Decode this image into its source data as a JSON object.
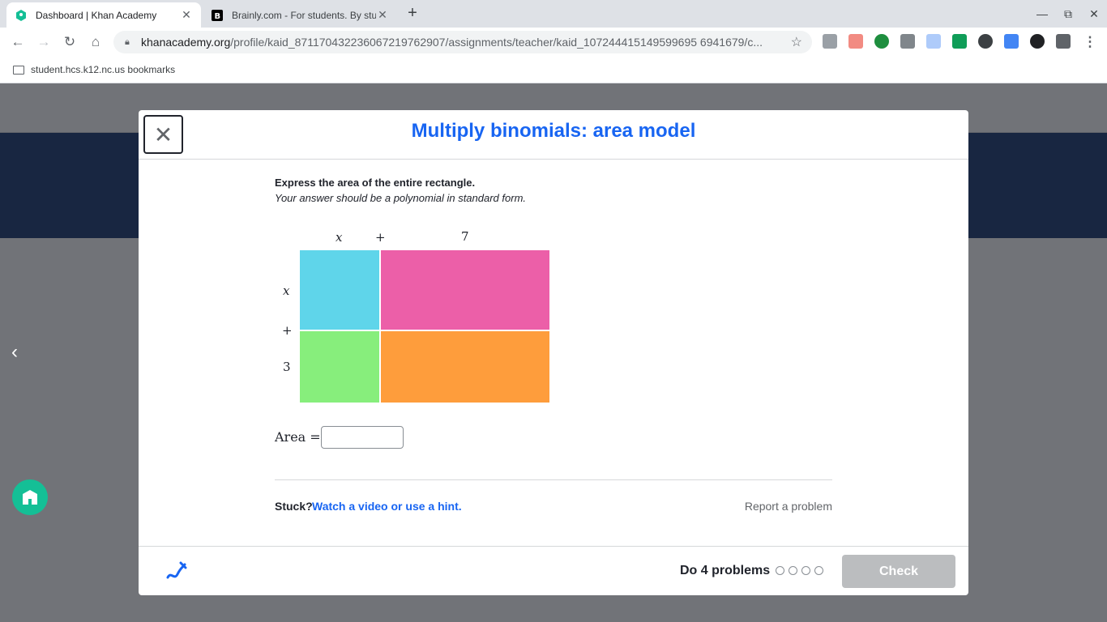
{
  "browser": {
    "tabs": [
      {
        "title": "Dashboard | Khan Academy",
        "active": true
      },
      {
        "title": "Brainly.com - For students. By students.",
        "active": false
      }
    ],
    "url_domain": "khanacademy.org",
    "url_path": "/profile/kaid_871170432236067219762907/assignments/teacher/kaid_107244415149599695 6941679/c...",
    "bookmark_folder": "student.hcs.k12.nc.us bookmarks"
  },
  "modal": {
    "title": "Multiply binomials: area model",
    "question": "Express the area of the entire rectangle.",
    "instruction": "Your answer should be a polynomial in standard form.",
    "diagram": {
      "top_labels": [
        "x",
        "+",
        "7"
      ],
      "side_labels": [
        "x",
        "+",
        "3"
      ],
      "colors": {
        "top_left": "#5fd5ea",
        "top_right": "#ec5fa8",
        "bottom_left": "#87ee7c",
        "bottom_right": "#fe9d3c"
      }
    },
    "area_label": "Area =",
    "area_value": "",
    "stuck_label": "Stuck?",
    "hint_link": "Watch a video or use a hint.",
    "report_link": "Report a problem",
    "progress_label": "Do 4 problems",
    "progress_completed": 0,
    "progress_total": 4,
    "check_label": "Check"
  }
}
